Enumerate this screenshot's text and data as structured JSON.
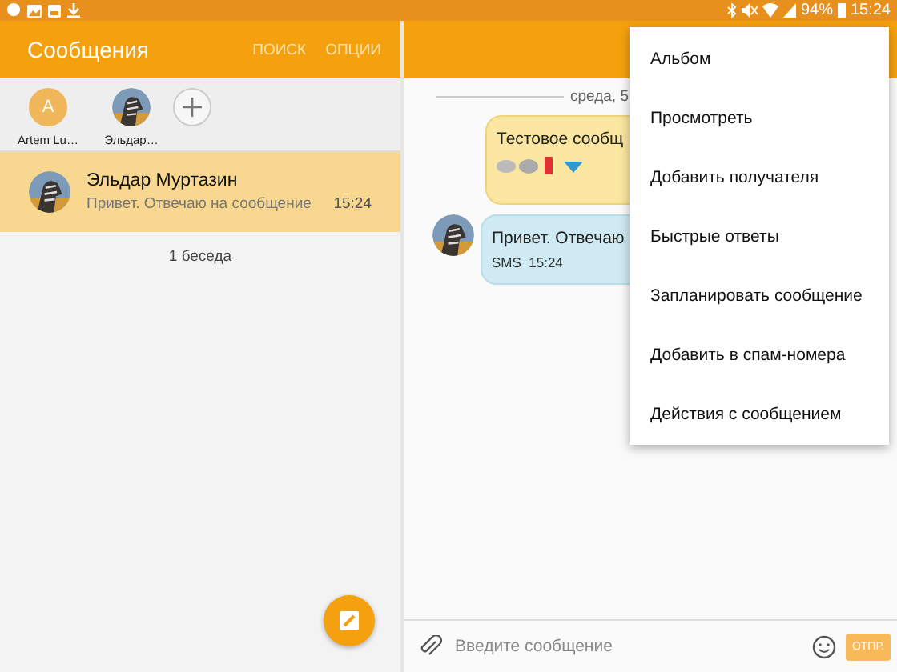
{
  "status_bar": {
    "battery": "94%",
    "time": "15:24"
  },
  "conversations_panel": {
    "title": "Сообщения",
    "actions": [
      "ПОИСК",
      "ОПЦИИ"
    ],
    "recent_contacts": [
      {
        "kind": "letter",
        "letter": "A",
        "name": "Artem Lu…"
      },
      {
        "kind": "picture",
        "name": "Эльдар…"
      }
    ],
    "conversations": [
      {
        "name": "Эльдар Муртазин",
        "preview": "Привет. Отвечаю на сообщение",
        "time": "15:24",
        "selected": true
      }
    ],
    "count": "1 беседа"
  },
  "chat_panel": {
    "date": "среда, 5",
    "messages": [
      {
        "kind": "sent",
        "text": "Тестовое сообщ",
        "emoji": true
      },
      {
        "kind": "received",
        "text": "Привет. Отвечаю",
        "meta": "SMS  15:24"
      }
    ],
    "input": {
      "placeholder": "Введите сообщение",
      "send": "ОТПР."
    }
  },
  "menu": [
    "Альбом",
    "Просмотреть",
    "Добавить получателя",
    "Быстрые ответы",
    "Запланировать сообщение",
    "Добавить в спам-номера",
    "Действия с сообщением"
  ]
}
